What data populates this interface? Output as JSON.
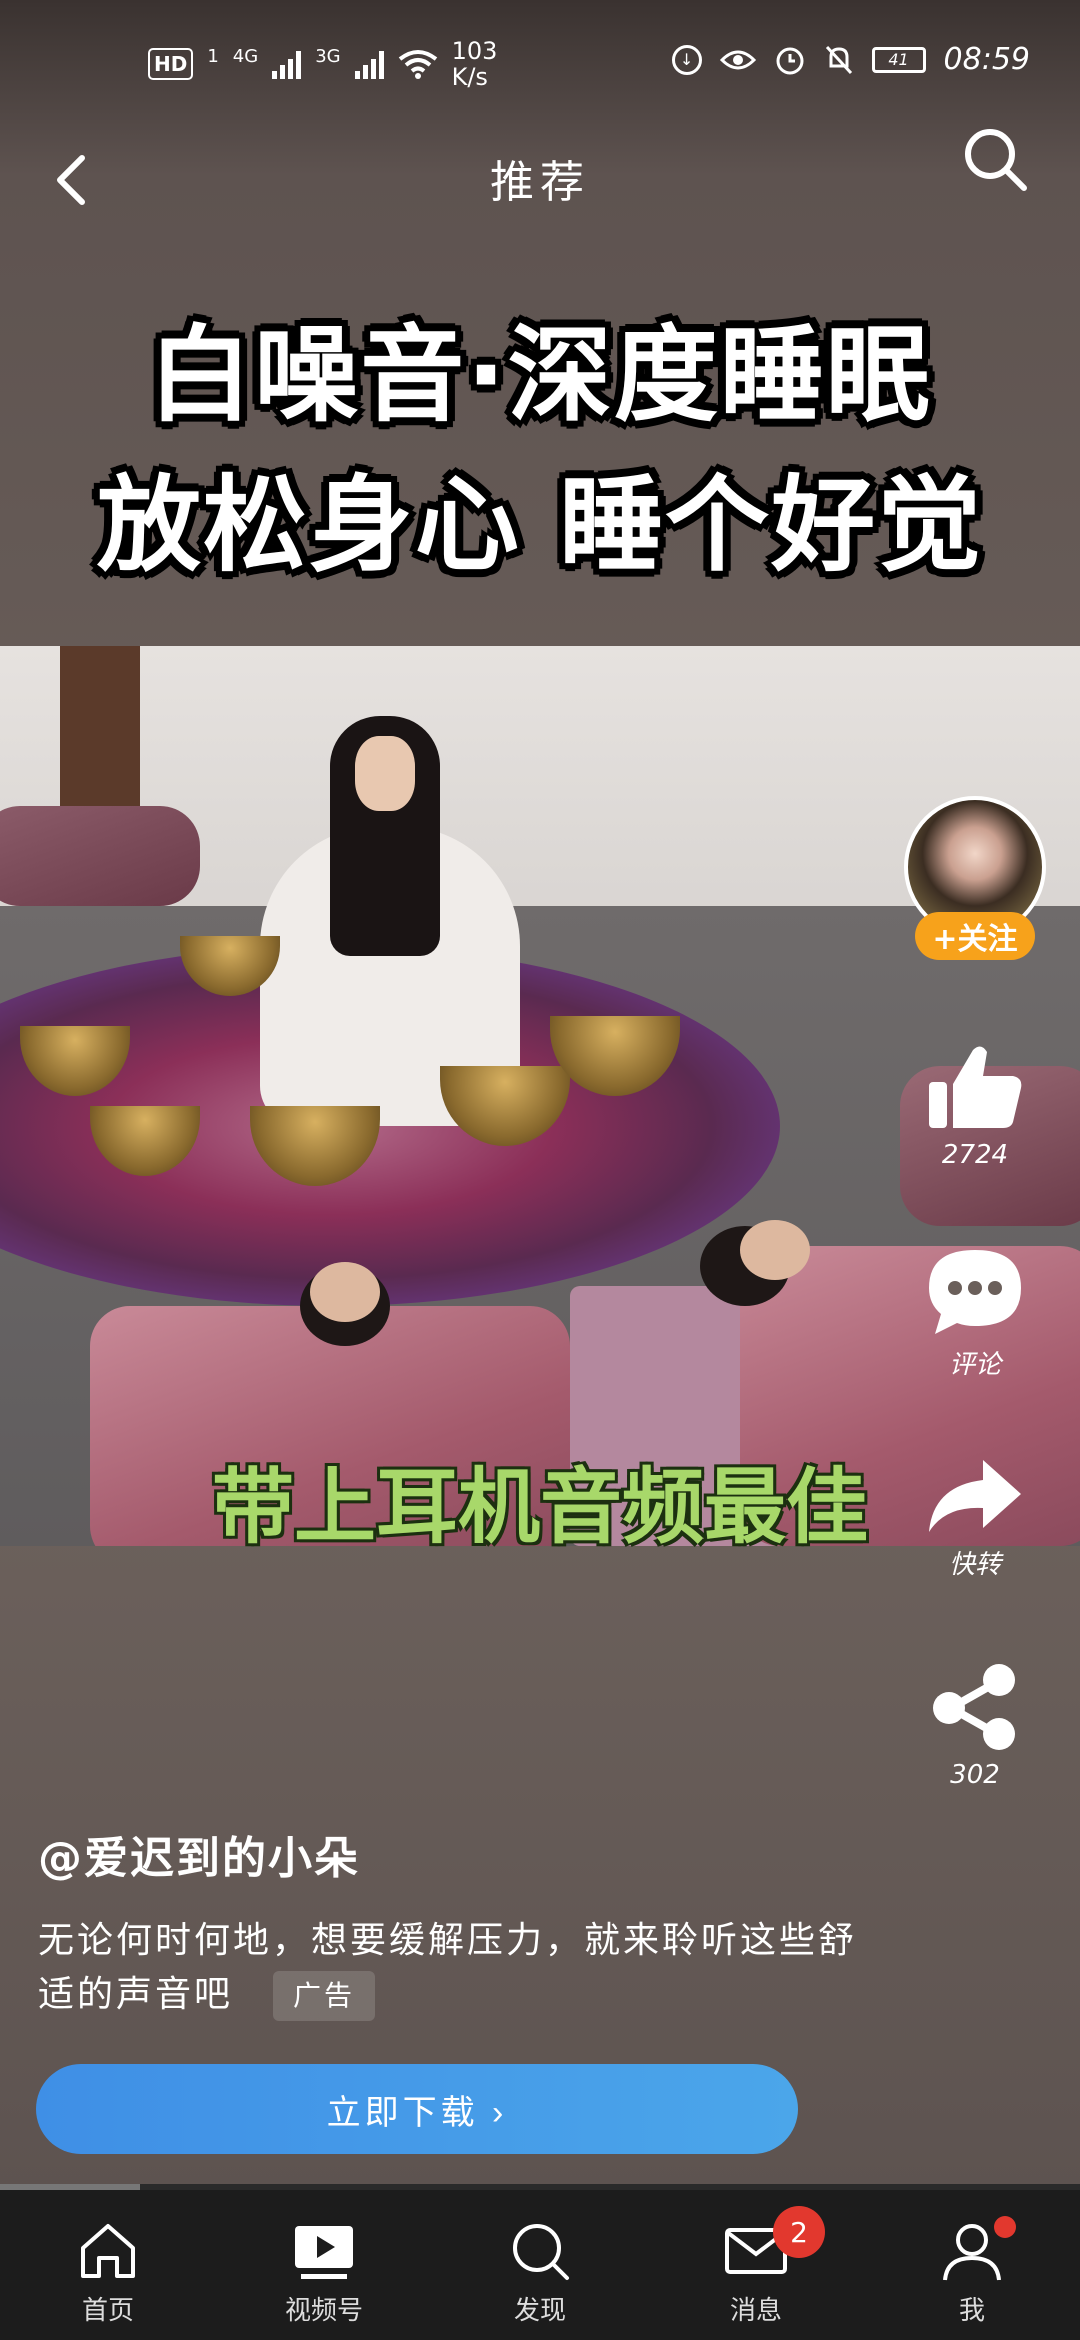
{
  "status_bar": {
    "hd": "HD",
    "sim": "1",
    "net1": "4G",
    "net2": "3G",
    "speed_value": "103",
    "speed_unit": "K/s",
    "battery": "41",
    "time": "08:59"
  },
  "header": {
    "title": "推荐"
  },
  "video": {
    "headline_line1": "白噪音·深度睡眠",
    "headline_line2": "放松身心 睡个好觉",
    "subtitle": "带上耳机音频最佳"
  },
  "actions": {
    "follow_label": "+关注",
    "likes": "2724",
    "comment_label": "评论",
    "forward_label": "快转",
    "shares": "302"
  },
  "caption": {
    "author": "@爱迟到的小朵",
    "text": "无论何时何地，想要缓解压力，就来聆听这些舒适的声音吧",
    "ad_label": "广告",
    "download_label": "立即下载 ›"
  },
  "nav": {
    "items": [
      {
        "label": "首页",
        "icon": "home-icon"
      },
      {
        "label": "视频号",
        "icon": "video-icon"
      },
      {
        "label": "发现",
        "icon": "search-icon"
      },
      {
        "label": "消息",
        "icon": "mail-icon",
        "badge": "2"
      },
      {
        "label": "我",
        "icon": "person-icon"
      }
    ]
  },
  "colors": {
    "download_button": "#4a9ee8",
    "follow_button": "#f7a21b",
    "badge": "#e2382e",
    "subtitle": "#a8d86a"
  }
}
